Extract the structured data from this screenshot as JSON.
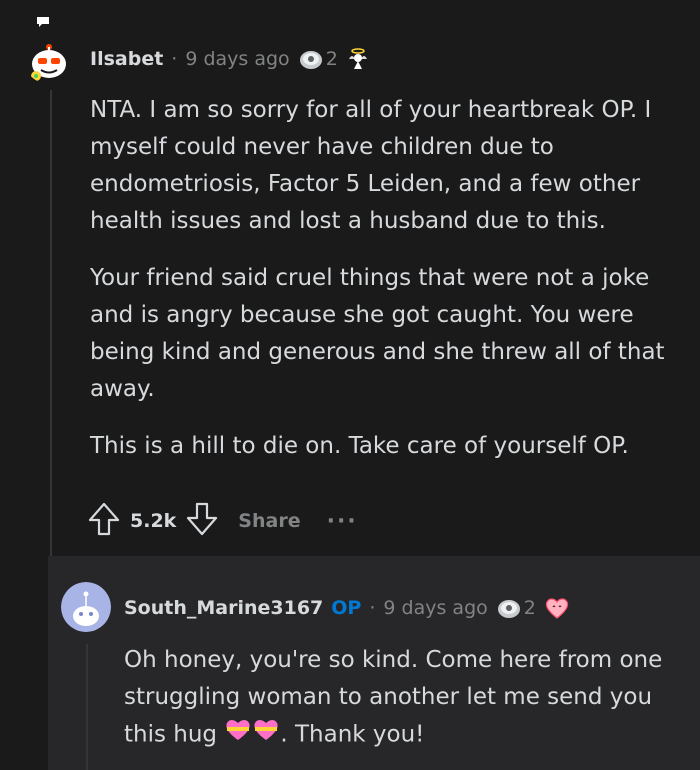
{
  "comment": {
    "username": "Ilsabet",
    "separator": "·",
    "time": "9 days ago",
    "award_count": "2",
    "paragraphs": [
      "NTA. I am so sorry for all of your heartbreak OP. I myself could never have children due to endometriosis, Factor 5 Leiden, and a few other health issues and lost a husband due to this.",
      "Your friend said cruel things that were not a joke and is angry because she got caught. You were being kind and generous and she threw all of that away.",
      "This is a hill to die on. Take care of yourself OP."
    ],
    "votes": "5.2k",
    "share_label": "Share",
    "more_label": "···"
  },
  "reply": {
    "username": "South_Marine3167",
    "op_badge": "OP",
    "separator": "·",
    "time": "9 days ago",
    "award_count": "2",
    "text_before": "Oh honey, you're so kind. Come here from one struggling woman to another let me send you this hug ",
    "text_after": ". Thank you!"
  },
  "colors": {
    "background": "#1a1a1b",
    "reply_background": "#272729",
    "text": "#d7dadc",
    "muted": "#818384",
    "op_blue": "#0079d3"
  },
  "icons": {
    "award_1": "silver-award-icon",
    "award_2": "angel-award-icon",
    "award_3": "wholesome-heart-award-icon",
    "upvote": "upvote-arrow-icon",
    "downvote": "downvote-arrow-icon",
    "hug_emoji": "heart-gift-emoji"
  }
}
